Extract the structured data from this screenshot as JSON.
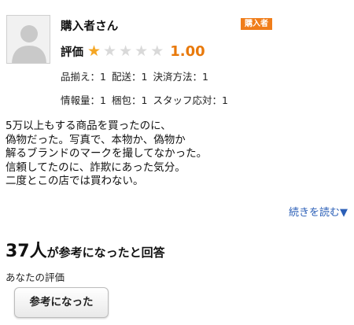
{
  "reviewer": {
    "name": "購入者さん",
    "badge": "購入者"
  },
  "rating": {
    "label": "評価",
    "score": "1.00",
    "value": 1,
    "max": 5,
    "star_color": "#f5a623",
    "star_empty_color": "#d9d9d9",
    "score_color": "#e8790b"
  },
  "sub_ratings": {
    "row1": [
      {
        "label": "品揃え",
        "value": "1"
      },
      {
        "label": "配送",
        "value": "1"
      },
      {
        "label": "決済方法",
        "value": "1"
      }
    ],
    "row2": [
      {
        "label": "情報量",
        "value": "1"
      },
      {
        "label": "梱包",
        "value": "1"
      },
      {
        "label": "スタッフ応対",
        "value": "1"
      }
    ]
  },
  "review": {
    "lines": [
      "5万以上もする商品を買ったのに、",
      "偽物だった。写真で、本物か、偽物か",
      "解るブランドのマークを撮してなかった。",
      "信頼してたのに、詐欺にあった気分。",
      "二度とこの店では買わない。"
    ],
    "read_more": "続きを読む▼"
  },
  "helpful": {
    "count": "37人",
    "text": "が参考になったと回答"
  },
  "your_evaluation": {
    "label": "あなたの評価",
    "button_label": "参考になった"
  },
  "colors": {
    "badge_bg": "#f07d1a",
    "link": "#2b5fb7"
  }
}
